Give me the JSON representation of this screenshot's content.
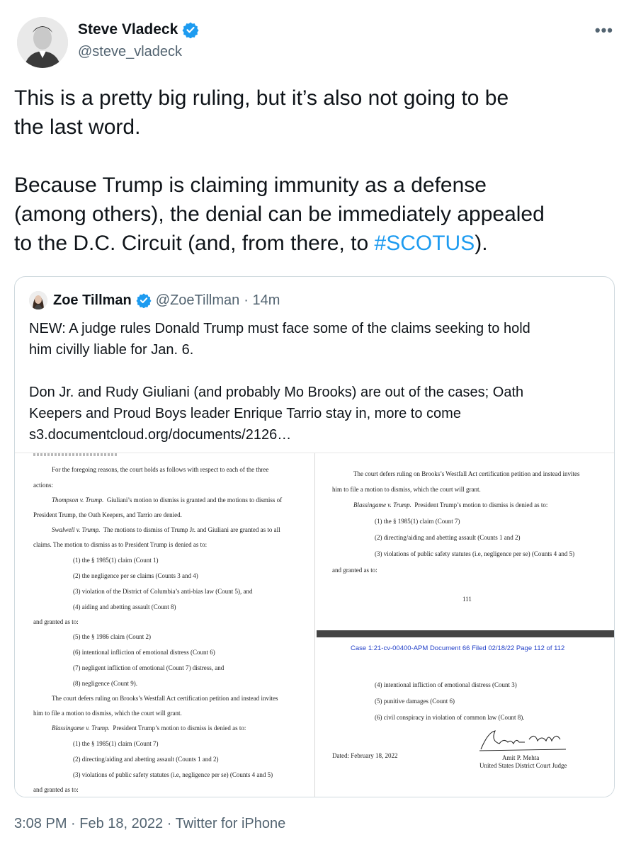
{
  "author": {
    "name": "Steve Vladeck",
    "handle": "@steve_vladeck"
  },
  "more_label": "•••",
  "tweet": {
    "lines_p1": [
      "This is a pretty big ruling, but it’s also not going to be",
      "the last word."
    ],
    "lines_p2_a": "Because Trump is claiming immunity as a defense",
    "lines_p2_b": "(among others), the denial can be immediately appealed",
    "lines_p2_c_prefix": "to the D.C. Circuit (and, from there, to ",
    "hashtag": "#SCOTUS",
    "lines_p2_c_suffix": ")."
  },
  "quote": {
    "name": "Zoe Tillman",
    "handle": "@ZoeTillman",
    "time": "· 14m",
    "lines": [
      "NEW: A judge rules Donald Trump must face some of the claims seeking to hold",
      "him civilly liable for Jan. 6."
    ],
    "lines2": [
      "Don Jr. and Rudy Giuliani (and probably Mo Brooks) are out of the cases; Oath",
      "Keepers and Proud Boys leader Enrique Tarrio stay in, more to come",
      "s3.documentcloud.org/documents/2126…"
    ]
  },
  "document": {
    "left": {
      "l1": "For the foregoing reasons, the court holds as follows with respect to each of the three",
      "l2": "actions:",
      "l3a": "Thompson v. Trump.",
      "l3b": "Giuliani’s motion to dismiss is granted and the motions to dismiss of",
      "l4": "President Trump, the Oath Keepers, and Tarrio are denied.",
      "l5a": "Swalwell v. Trump.",
      "l5b": "The motions to dismiss of Trump Jr. and Giuliani are granted as to all",
      "l6": "claims.  The motion to dismiss as to President Trump is denied as to:",
      "l7": "(1) the § 1985(1) claim (Count 1)",
      "l8": "(2) the negligence per se claims (Counts 3 and 4)",
      "l9": "(3) violation of the District of Columbia’s anti-bias law (Count 5), and",
      "l10": "(4) aiding and abetting assault (Count 8)",
      "l11": "and granted as to:",
      "l12": "(5) the § 1986 claim (Count 2)",
      "l13": "(6) intentional infliction of emotional distress (Count 6)",
      "l14": "(7) negligent infliction of emotional (Count 7) distress, and",
      "l15": "(8) negligence (Count 9).",
      "l16": "The court defers ruling on Brooks’s Westfall Act certification petition and instead invites",
      "l17": "him to file a motion to dismiss, which the court will grant.",
      "l18a": "Blassingame v. Trump.",
      "l18b": "President Trump’s motion to dismiss is denied as to:",
      "l19": "(1) the § 1985(1) claim (Count 7)",
      "l20": "(2) directing/aiding and abetting assault (Counts 1 and 2)",
      "l21": "(3) violations of public safety statutes (i.e, negligence per se) (Counts 4 and 5)",
      "l22": "and granted as to:"
    },
    "right": {
      "r1": "The court defers ruling on Brooks’s Westfall Act certification petition and instead invites",
      "r2": "him to file a motion to dismiss, which the court will grant.",
      "r3a": "Blassingame v. Trump.",
      "r3b": "President Trump’s motion to dismiss is denied as to:",
      "r4": "(1) the § 1985(1) claim (Count 7)",
      "r5": "(2) directing/aiding and abetting assault (Counts 1 and 2)",
      "r6": "(3) violations of public safety statutes (i.e, negligence per se) (Counts 4 and 5)",
      "r7": "and granted as to:",
      "page_num": "111",
      "case_header": "Case 1:21-cv-00400-APM   Document 66   Filed 02/18/22   Page 112 of 112",
      "r8": "(4) intentional infliction of emotional distress (Count 3)",
      "r9": "(5) punitive damages (Count 6)",
      "r10": "(6) civil conspiracy in violation of common law (Count 8).",
      "dated": "Dated:  February 18, 2022",
      "judge_name": "Amit P. Mehta",
      "judge_title": "United States District Court Judge"
    }
  },
  "footer": {
    "time": "3:08 PM",
    "sep1": "·",
    "date": "Feb 18, 2022",
    "sep2": "·",
    "source": "Twitter for iPhone"
  }
}
